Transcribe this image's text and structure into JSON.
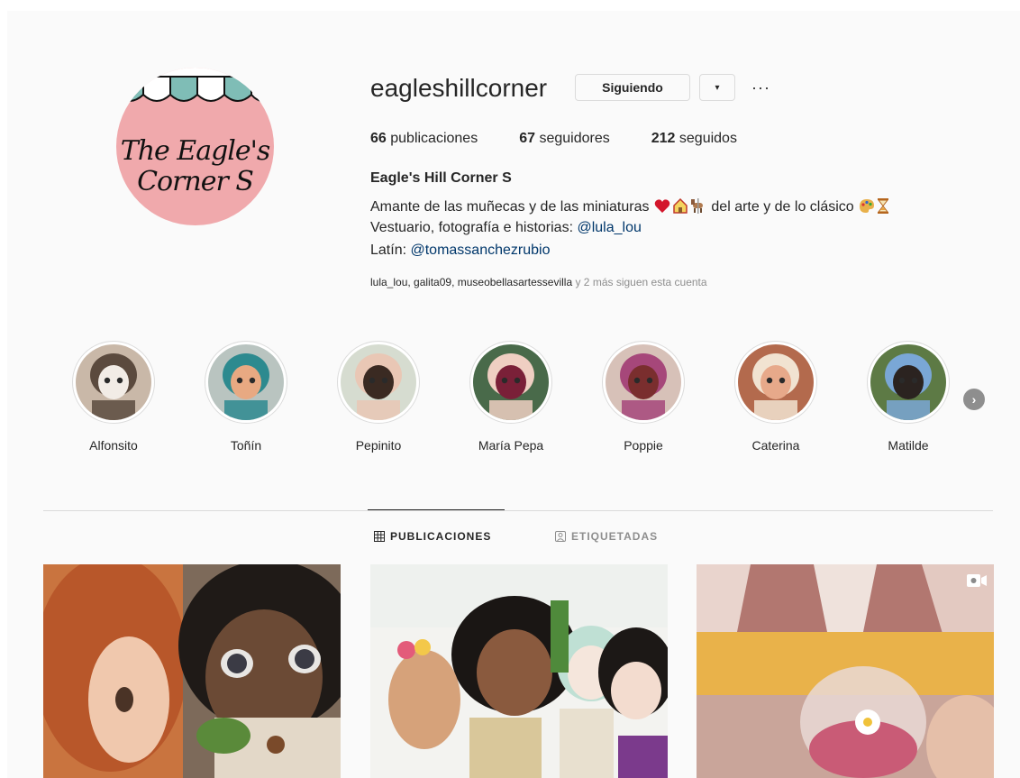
{
  "profile": {
    "avatar_text_line1": "The Eagle's",
    "avatar_text_line2": "Corner S",
    "username": "eagleshillcorner",
    "follow_label": "Siguiendo",
    "dropdown_icon": "chevron-down-icon",
    "more_icon": "more-options-icon",
    "more_glyph": "···",
    "dropdown_glyph": "▾"
  },
  "stats": [
    {
      "count": "66",
      "label": "publicaciones"
    },
    {
      "count": "67",
      "label": "seguidores"
    },
    {
      "count": "212",
      "label": "seguidos"
    }
  ],
  "bio": {
    "full_name": "Eagle's Hill Corner S",
    "line1": "Amante de las muñecas y de las miniaturas",
    "line1_after": "del arte y de lo clásico",
    "line2_prefix": "Vestuario, fotografía e historias: ",
    "line2_link": "@lula_lou",
    "line3_prefix": "Latín: ",
    "line3_link": "@tomassanchezrubio",
    "followed_by_names": "lula_lou, galita09, museobellasartessevilla",
    "followed_by_rest": " y 2 más siguen esta cuenta"
  },
  "highlights": [
    {
      "label": "Alfonsito",
      "colors": [
        "#c9b8a8",
        "#f2ece6",
        "#5b4a3e"
      ]
    },
    {
      "label": "Toñín",
      "colors": [
        "#b9c4c0",
        "#e8a982",
        "#2d8a8f"
      ]
    },
    {
      "label": "Pepinito",
      "colors": [
        "#d6dcd0",
        "#3a2a22",
        "#e9c7b5"
      ]
    },
    {
      "label": "María Pepa",
      "colors": [
        "#496a4a",
        "#7a2038",
        "#efcfc2"
      ]
    },
    {
      "label": "Poppie",
      "colors": [
        "#d7c1b8",
        "#7a2e2e",
        "#a6477a"
      ]
    },
    {
      "label": "Caterina",
      "colors": [
        "#b36a4d",
        "#e7a98a",
        "#f1e3d1"
      ]
    },
    {
      "label": "Matilde",
      "colors": [
        "#5d7a45",
        "#2b2320",
        "#7aa7d6"
      ]
    }
  ],
  "highlights_next_glyph": "›",
  "tabs": {
    "posts_label": "PUBLICACIONES",
    "tagged_label": "ETIQUETADAS"
  },
  "posts": [
    {
      "name": "post-1",
      "video": false
    },
    {
      "name": "post-2",
      "video": false
    },
    {
      "name": "post-3",
      "video": true
    }
  ],
  "colors": {
    "link": "#00376b",
    "background": "#fafafa",
    "border": "#dbdbdb",
    "muted": "#8e8e8e"
  }
}
